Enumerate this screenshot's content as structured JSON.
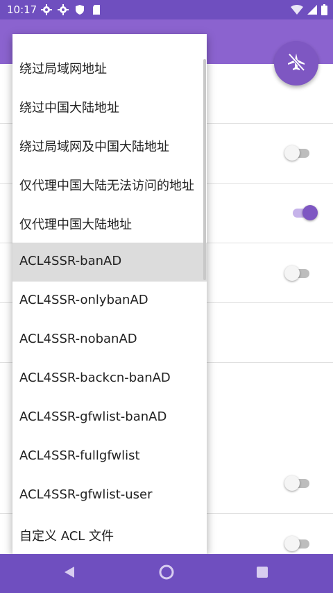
{
  "status_bar": {
    "time": "10:17",
    "left_icons": [
      "gear-icon",
      "gear-icon",
      "shield-icon",
      "sd-card-icon"
    ],
    "right_icons": [
      "wifi-icon",
      "signal-icon",
      "battery-icon"
    ]
  },
  "app_bar": {
    "color": "#8b63cf"
  },
  "fab": {
    "icon": "airplane-off-icon",
    "color": "#7e57c2"
  },
  "settings_rows": {
    "toggles": [
      {
        "name": "toggle-1",
        "state": "off"
      },
      {
        "name": "toggle-2",
        "state": "on"
      },
      {
        "name": "toggle-3",
        "state": "off"
      },
      {
        "name": "toggle-4",
        "state": "off"
      },
      {
        "name": "toggle-5",
        "state": "off"
      }
    ]
  },
  "dropdown": {
    "selected_index": 5,
    "items": [
      {
        "label": "绕过局域网地址"
      },
      {
        "label": "绕过中国大陆地址"
      },
      {
        "label": "绕过局域网及中国大陆地址"
      },
      {
        "label": "仅代理中国大陆无法访问的地址"
      },
      {
        "label": "仅代理中国大陆地址"
      },
      {
        "label": "ACL4SSR-banAD"
      },
      {
        "label": "ACL4SSR-onlybanAD"
      },
      {
        "label": "ACL4SSR-nobanAD"
      },
      {
        "label": "ACL4SSR-backcn-banAD"
      },
      {
        "label": "ACL4SSR-gfwlist-banAD"
      },
      {
        "label": "ACL4SSR-fullgfwlist"
      },
      {
        "label": "ACL4SSR-gfwlist-user"
      },
      {
        "label": "自定义 ACL 文件"
      }
    ]
  },
  "nav_bar": {
    "buttons": [
      "back-icon",
      "home-icon",
      "recents-icon"
    ]
  }
}
